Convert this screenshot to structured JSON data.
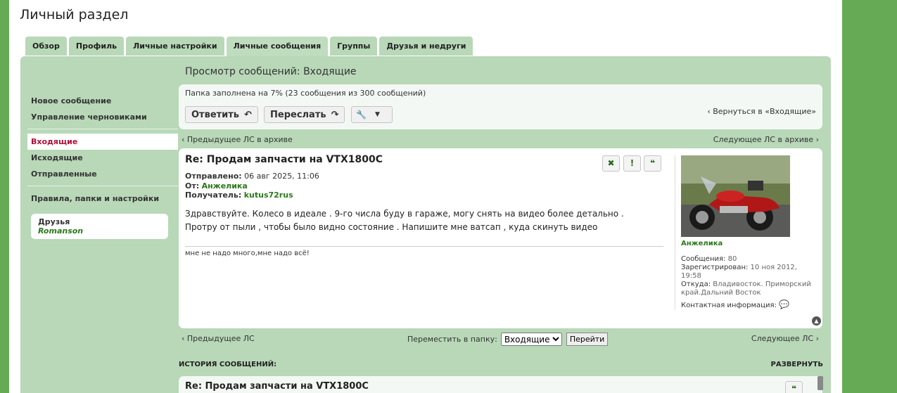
{
  "page_title": "Личный раздел",
  "tabs": [
    "Обзор",
    "Профиль",
    "Личные настройки",
    "Личные сообщения",
    "Группы",
    "Друзья и недруги"
  ],
  "nav": {
    "new_message": "Новое сообщение",
    "drafts": "Управление черновиками",
    "inbox": "Входящие",
    "outbox": "Исходящие",
    "sent": "Отправленные",
    "rules": "Правила, папки и настройки",
    "friends_title": "Друзья",
    "friend_name": "Romanson"
  },
  "view": {
    "title": "Просмотр сообщений: Входящие",
    "folder_info": "Папка заполнена на 7% (23 сообщения из 300 сообщений)",
    "reply": "Ответить",
    "forward": "Переслать",
    "back": "Вернуться в «Входящие»",
    "prev_archive": "Предыдущее ЛС в архиве",
    "next_archive": "Следующее ЛС в архиве",
    "prev_pm": "Предыдущее ЛС",
    "next_pm": "Следующее ЛС"
  },
  "message": {
    "title": "Re: Продам запчасти на VTX1800C",
    "sent_label": "Отправлено:",
    "sent_value": "06 авг 2025, 11:06",
    "from_label": "От:",
    "from_value": "Анжелика",
    "to_label": "Получатель:",
    "to_value": "kutus72rus",
    "body": "Здравствуйте. Колесо в идеале . 9-го числа буду в гараже, могу снять на видео более детально . Протру от пыли , чтобы было видно состояние . Напишите мне ватсап , куда скинуть видео",
    "signature": "мне не надо много,мне надо всё!"
  },
  "author": {
    "name": "Анжелика",
    "posts_label": "Сообщения:",
    "posts_value": "80",
    "registered_label": "Зарегистрирован:",
    "registered_value": "10 ноя 2012, 19:58",
    "location_label": "Откуда:",
    "location_value": "Владивосток. Приморский край.Дальний Восток",
    "contact_label": "Контактная информация:"
  },
  "move": {
    "label": "Переместить в папку:",
    "selected": "Входящие",
    "go": "Перейти"
  },
  "history": {
    "title": "ИСТОРИЯ СООБЩЕНИЙ:",
    "expand": "РАЗВЕРНУТЬ",
    "item_title": "Re: Продам запчасти на VTX1800C"
  },
  "colors": {
    "accent_green": "#2a7a1a",
    "panel_green": "#b8d8b8",
    "gutter_green": "#66aa55",
    "active_red": "#b0103a"
  }
}
